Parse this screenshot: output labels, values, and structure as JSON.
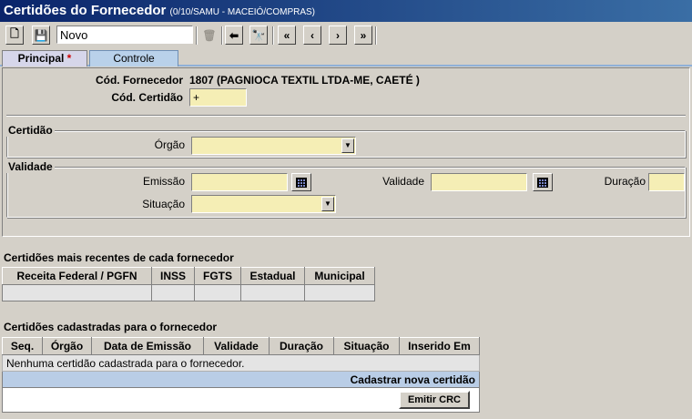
{
  "window": {
    "title": "Certidões do Fornecedor",
    "subtitle": "(0/10/SAMU - MACEIÓ/COMPRAS)"
  },
  "toolbar": {
    "name_value": "Novo",
    "buttons": [
      "new-icon",
      "save-icon",
      "trash-icon",
      "arrow-left-icon",
      "binoculars-icon",
      "first-record-icon",
      "previous-record-icon",
      "next-record-icon",
      "last-record-icon"
    ],
    "glyphs": {
      "new": "🗋",
      "save": "💾",
      "trash": "🗑",
      "back": "⬅",
      "find": "🔭",
      "first": "«",
      "prev": "‹",
      "next": "›",
      "last": "»"
    }
  },
  "tabs": [
    {
      "label": "Principal",
      "required_mark": "*"
    },
    {
      "label": "Controle"
    }
  ],
  "form": {
    "fornecedor_label": "Cód. Fornecedor",
    "fornecedor_value": "1807 (PAGNIOCA TEXTIL LTDA-ME, CAETÉ )",
    "certidao_code_label": "Cód. Certidão",
    "certidao_code_value": "+",
    "certidao_group": "Certidão",
    "orgao_label": "Órgão",
    "orgao_value": "",
    "validade_group": "Validade",
    "emissao_label": "Emissão",
    "emissao_value": "",
    "validade_label": "Validade",
    "validade_value": "",
    "duracao_label": "Duração",
    "duracao_value": "",
    "situacao_label": "Situação",
    "situacao_value": ""
  },
  "recent": {
    "title": "Certidões mais recentes de cada fornecedor",
    "columns": [
      "Receita Federal / PGFN",
      "INSS",
      "FGTS",
      "Estadual",
      "Municipal"
    ]
  },
  "registered": {
    "title": "Certidões cadastradas para o fornecedor",
    "columns": [
      "Seq.",
      "Órgão",
      "Data de Emissão",
      "Validade",
      "Duração",
      "Situação",
      "Inserido Em"
    ],
    "empty_message": "Nenhuma certidão cadastrada para o fornecedor.",
    "add_link": "Cadastrar nova certidão",
    "crc_button": "Emitir CRC"
  },
  "colors": {
    "titlebar_start": "#0a246a",
    "titlebar_end": "#3a6ea5",
    "field_bg": "#f5eeb5",
    "tab_active": "#d6d6ea",
    "tab_inactive": "#b9d1ea",
    "add_row": "#b9cde6"
  }
}
